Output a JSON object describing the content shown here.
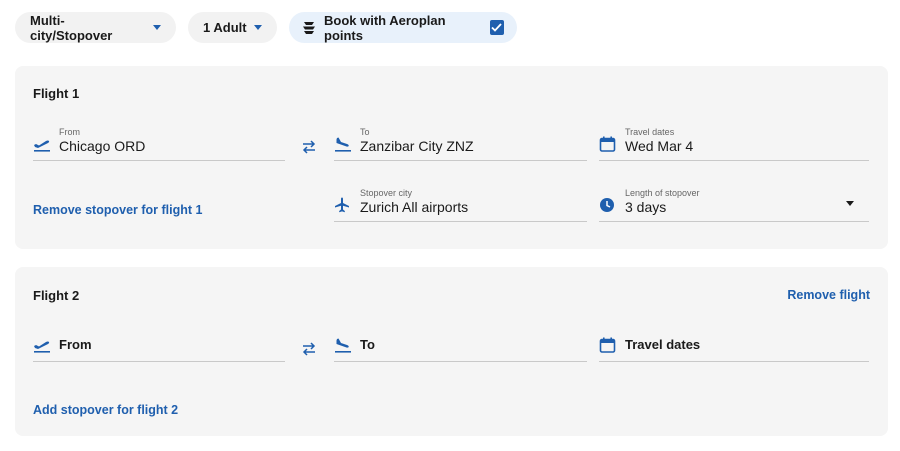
{
  "topbar": {
    "trip_type": "Multi-city/Stopover",
    "passengers": "1 Adult",
    "aeroplan": "Book with Aeroplan points",
    "aeroplan_checked": true
  },
  "flight1": {
    "title": "Flight 1",
    "from": {
      "label": "From",
      "value": "Chicago ORD"
    },
    "to": {
      "label": "To",
      "value": "Zanzibar City ZNZ"
    },
    "dates": {
      "label": "Travel dates",
      "value": "Wed Mar 4"
    },
    "stopover_city": {
      "label": "Stopover city",
      "value": "Zurich All airports"
    },
    "stopover_length": {
      "label": "Length of stopover",
      "value": "3 days"
    },
    "remove_stopover": "Remove stopover for flight 1"
  },
  "flight2": {
    "title": "Flight 2",
    "remove_flight": "Remove flight",
    "from_placeholder": "From",
    "to_placeholder": "To",
    "dates_placeholder": "Travel dates",
    "add_stopover": "Add stopover for flight 2"
  },
  "colors": {
    "accent": "#1f5fae",
    "card": "#f5f5f5",
    "chip": "#f2f2f2",
    "aeroplan_chip": "#e8f1fb"
  },
  "icons": [
    "caret-down-icon",
    "aeroplan-logo-icon",
    "checkbox-checked-icon",
    "takeoff-icon",
    "landing-icon",
    "swap-icon",
    "calendar-icon",
    "plane-icon",
    "clock-icon"
  ]
}
